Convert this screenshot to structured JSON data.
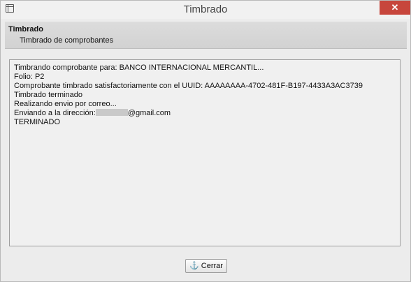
{
  "window": {
    "title": "Timbrado",
    "close_glyph": "✕",
    "app_icon": "window-icon"
  },
  "header": {
    "title": "Timbrado",
    "subtitle": "Timbrado de comprobantes"
  },
  "log": {
    "lines": [
      "Timbrando comprobante para: BANCO INTERNACIONAL MERCANTIL...",
      "Folio: P2",
      "Comprobante timbrado satisfactoriamente con el UUID: AAAAAAAA-4702-481F-B197-4433A3AC3739",
      "Timbrado terminado",
      "Realizando envio por correo...",
      "Enviando a la dirección:",
      "@gmail.com",
      "TERMINADO"
    ]
  },
  "footer": {
    "close_label": "Cerrar",
    "close_icon": "anchor-icon",
    "close_icon_glyph": "⚓"
  }
}
